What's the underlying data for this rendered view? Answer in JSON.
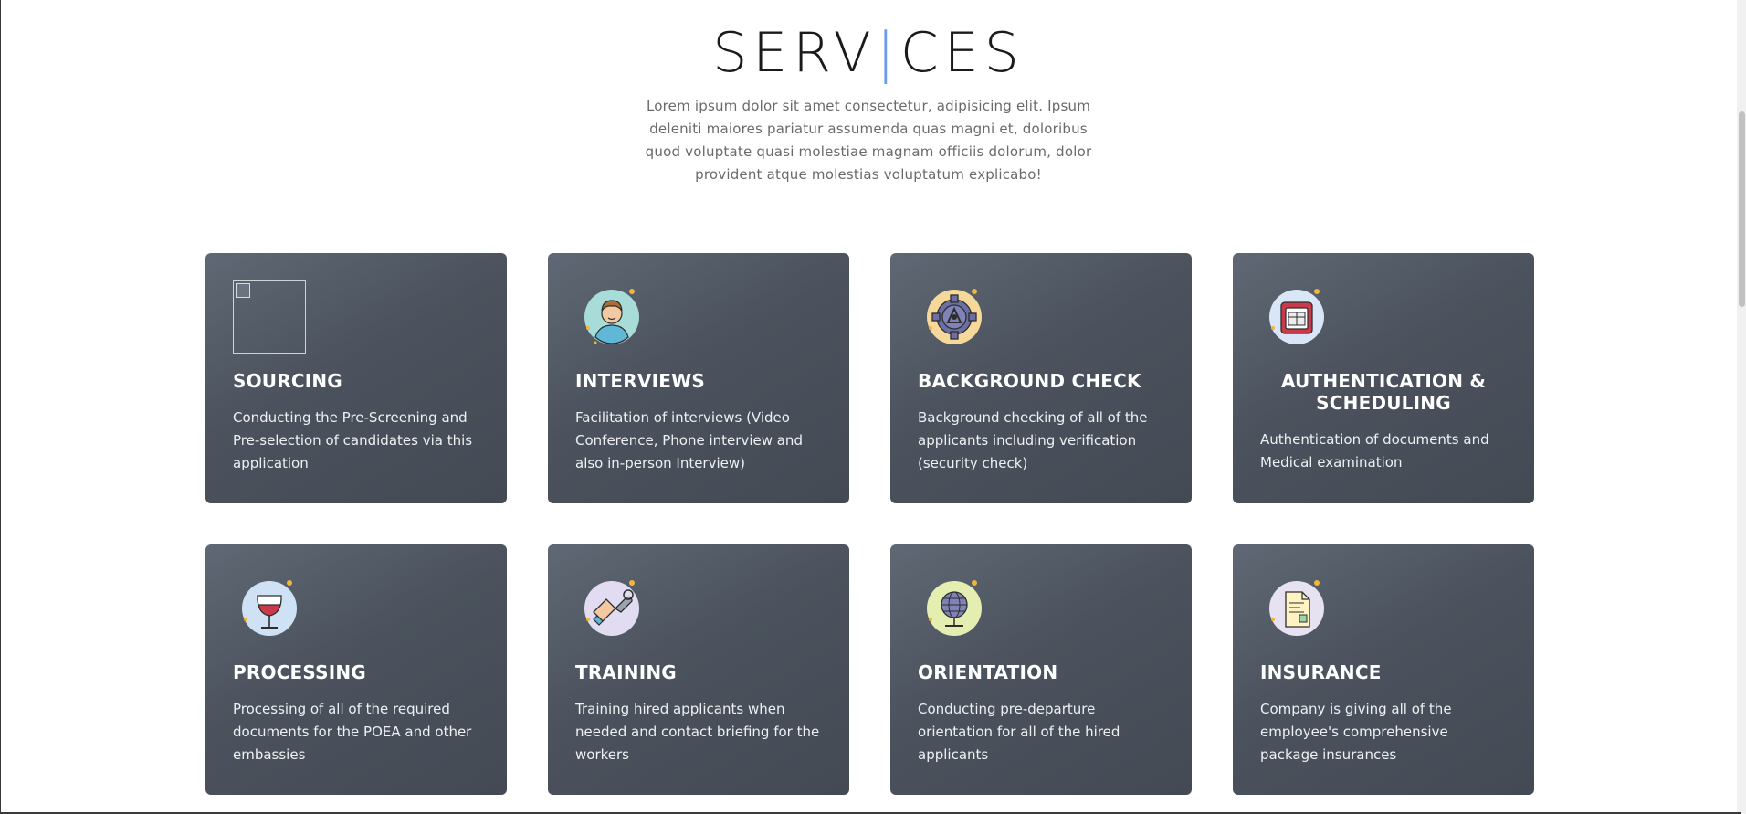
{
  "section": {
    "title_part1": "SERV",
    "title_cursor": "|",
    "title_part2": "CES",
    "description": "Lorem ipsum dolor sit amet consectetur, adipisicing elit. Ipsum deleniti maiores pariatur assumenda quas magni et, doloribus quod voluptate quasi molestiae magnam officiis dolorum, dolor provident atque molestias voluptatum explicabo!"
  },
  "colors": {
    "accent": "#6b9cf0",
    "card_bg": "#4b525d"
  },
  "services": [
    {
      "title": "SOURCING",
      "text": "Conducting the Pre-Screening and Pre-selection of candidates via this application",
      "icon": "broken-image-icon"
    },
    {
      "title": "INTERVIEWS",
      "text": "Facilitation of interviews (Video Conference, Phone interview and also in-person Interview)",
      "icon": "person-icon"
    },
    {
      "title": "BACKGROUND CHECK",
      "text": "Background checking of all of the applicants including verification (security check)",
      "icon": "gear-icon"
    },
    {
      "title": "AUTHENTICATION & SCHEDULING",
      "text": "Authentication of documents and Medical examination",
      "icon": "calendar-icon"
    },
    {
      "title": "PROCESSING",
      "text": "Processing of all of the required documents for the POEA and other embassies",
      "icon": "wine-glass-icon"
    },
    {
      "title": "TRAINING",
      "text": "Training hired applicants when needed and contact briefing for the workers",
      "icon": "handshake-wrench-icon"
    },
    {
      "title": "ORIENTATION",
      "text": "Conducting pre-departure orientation for all of the hired applicants",
      "icon": "globe-icon"
    },
    {
      "title": "INSURANCE",
      "text": "Company is giving all of the employee's comprehensive package insurances",
      "icon": "document-icon"
    }
  ]
}
